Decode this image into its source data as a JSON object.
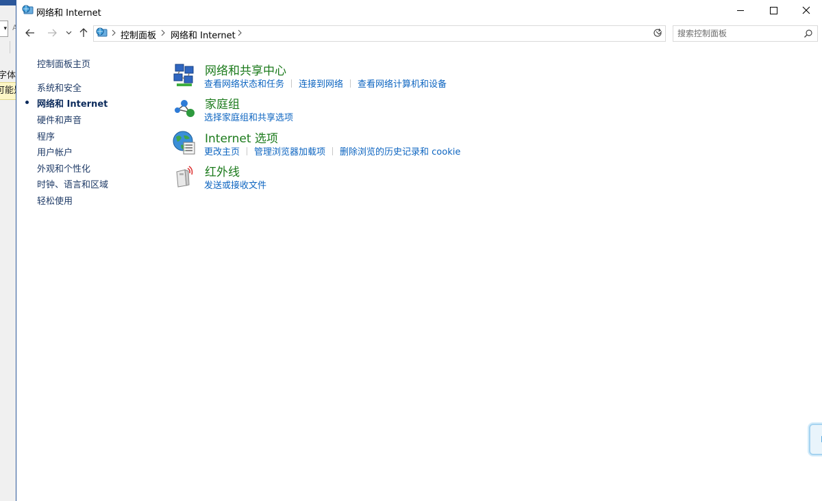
{
  "window": {
    "title": "网络和 Internet"
  },
  "background_window": {
    "text_1": "字体",
    "text_2": "可能是"
  },
  "address_bar": {
    "crumbs": [
      "控制面板",
      "网络和 Internet"
    ]
  },
  "search": {
    "placeholder": "搜索控制面板"
  },
  "sidebar": {
    "home": "控制面板主页",
    "items": [
      {
        "label": "系统和安全"
      },
      {
        "label": "网络和 Internet",
        "current": true
      },
      {
        "label": "硬件和声音"
      },
      {
        "label": "程序"
      },
      {
        "label": "用户帐户"
      },
      {
        "label": "外观和个性化"
      },
      {
        "label": "时钟、语言和区域"
      },
      {
        "label": "轻松使用"
      }
    ]
  },
  "categories": [
    {
      "title": "网络和共享中心",
      "icon": "network-sharing-icon",
      "links": [
        "查看网络状态和任务",
        "连接到网络",
        "查看网络计算机和设备"
      ]
    },
    {
      "title": "家庭组",
      "icon": "homegroup-icon",
      "links": [
        "选择家庭组和共享选项"
      ]
    },
    {
      "title": "Internet 选项",
      "icon": "internet-options-icon",
      "links": [
        "更改主页",
        "管理浏览器加载项",
        "删除浏览的历史记录和 cookie"
      ]
    },
    {
      "title": "红外线",
      "icon": "infrared-icon",
      "links": [
        "发送或接收文件"
      ]
    }
  ],
  "ime": {
    "mode": "中"
  },
  "colors": {
    "link": "#0c64c0",
    "category_title": "#1b7a1b",
    "nav_text": "#1e3a66"
  }
}
